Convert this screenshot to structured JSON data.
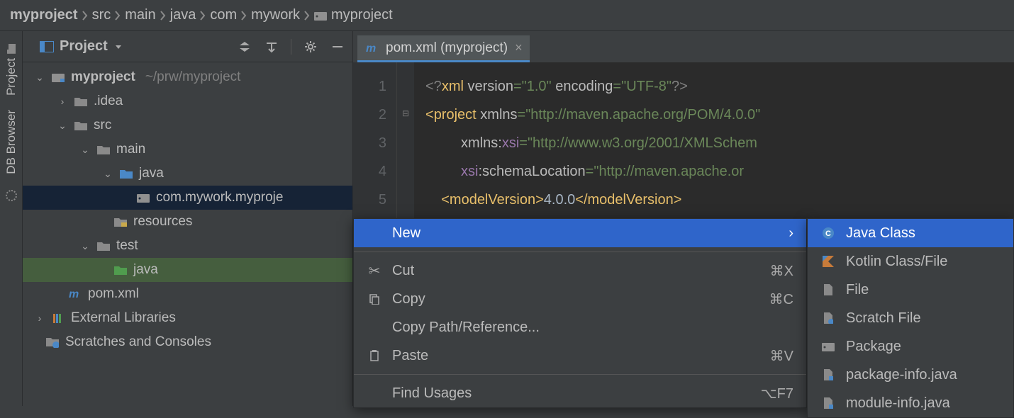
{
  "breadcrumb": [
    {
      "label": "myproject",
      "bold": true
    },
    {
      "label": "src"
    },
    {
      "label": "main"
    },
    {
      "label": "java"
    },
    {
      "label": "com"
    },
    {
      "label": "mywork"
    },
    {
      "label": "myproject",
      "icon": "pkg"
    }
  ],
  "side_tabs": {
    "project": "Project",
    "db_browser": "DB Browser"
  },
  "panel": {
    "title": "Project"
  },
  "tree": {
    "root": {
      "label": "myproject",
      "path": "~/prw/myproject"
    },
    "idea": ".idea",
    "src": "src",
    "main": "main",
    "java": "java",
    "pkg": "com.mywork.myproje",
    "resources": "resources",
    "test": "test",
    "test_java": "java",
    "pom": "pom.xml",
    "ext": "External Libraries",
    "scratch": "Scratches and Consoles"
  },
  "tab": {
    "label": "pom.xml (myproject)"
  },
  "code": {
    "l1_a": "<?",
    "l1_b": "xml ",
    "l1_c": "version",
    "l1_d": "=",
    "l1_e": "\"1.0\" ",
    "l1_f": "encoding",
    "l1_g": "=",
    "l1_h": "\"UTF-8\"",
    "l1_i": "?>",
    "l2_a": "<",
    "l2_b": "project ",
    "l2_c": "xmlns",
    "l2_d": "=",
    "l2_e": "\"http://maven.apache.org/POM/4.0.0\"",
    "l3_a": "         ",
    "l3_b": "xmlns:",
    "l3_c": "xsi",
    "l3_d": "=",
    "l3_e": "\"http://www.w3.org/2001/XMLSchem",
    "l4_a": "         ",
    "l4_b": "xsi",
    "l4_c": ":schemaLocation",
    "l4_d": "=",
    "l4_e": "\"http://maven.apache.or",
    "l5_a": "    <",
    "l5_b": "modelVersion",
    "l5_c": ">",
    "l5_d": "4.0.0",
    "l5_e": "</",
    "l5_f": "modelVersion",
    "l5_g": ">"
  },
  "gutter": [
    "1",
    "2",
    "3",
    "4",
    "5"
  ],
  "context_menu": {
    "new": "New",
    "cut": "Cut",
    "cut_sc": "⌘X",
    "copy": "Copy",
    "copy_sc": "⌘C",
    "copy_path": "Copy Path/Reference...",
    "paste": "Paste",
    "paste_sc": "⌘V",
    "find": "Find Usages",
    "find_sc": "⌥F7"
  },
  "submenu": {
    "java_class": "Java Class",
    "kotlin": "Kotlin Class/File",
    "file": "File",
    "scratch": "Scratch File",
    "package": "Package",
    "pkg_info": "package-info.java",
    "mod_info": "module-info.java"
  }
}
